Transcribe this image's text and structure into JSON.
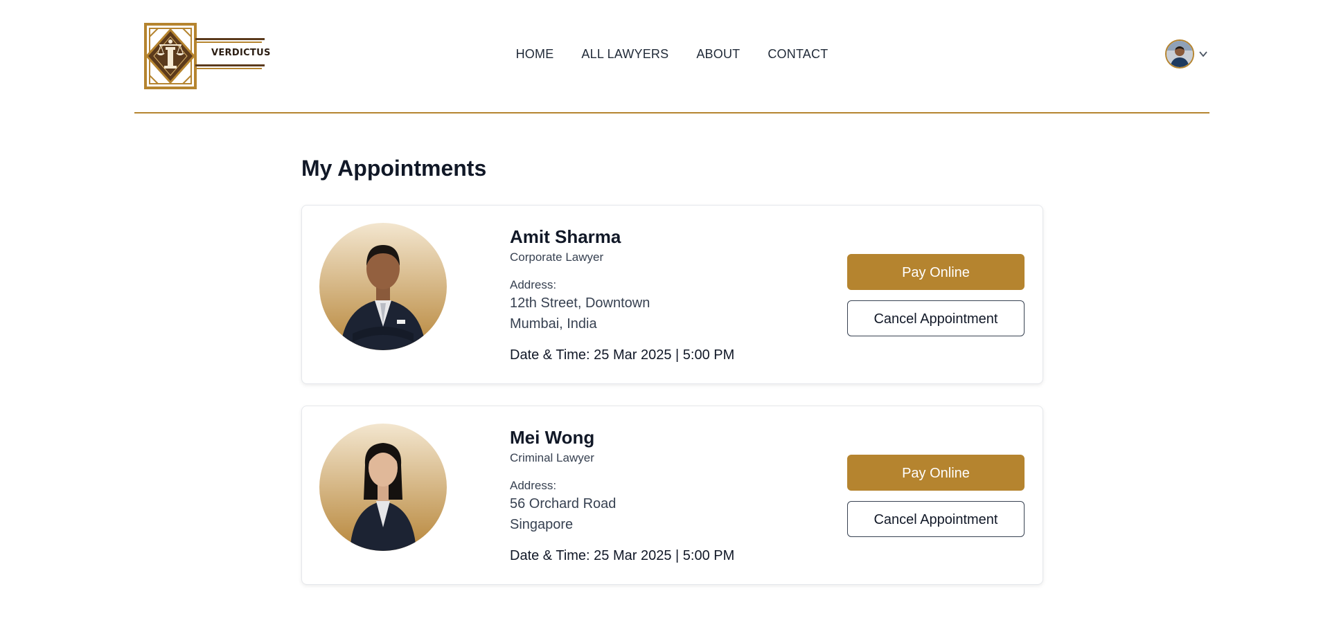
{
  "brand": {
    "name": "VERDICTUS",
    "accent_color": "#b5842f",
    "dark_color": "#5b3a1c"
  },
  "nav": {
    "items": [
      {
        "label": "HOME"
      },
      {
        "label": "ALL LAWYERS"
      },
      {
        "label": "ABOUT"
      },
      {
        "label": "CONTACT"
      }
    ]
  },
  "profile": {
    "avatar_icon": "user-avatar",
    "menu_icon": "chevron-down-icon"
  },
  "page": {
    "title": "My Appointments"
  },
  "appointments": [
    {
      "name": "Amit Sharma",
      "specialty": "Corporate Lawyer",
      "address_label": "Address:",
      "address_line1": "12th Street, Downtown",
      "address_line2": "Mumbai, India",
      "datetime_label": "Date & Time:",
      "datetime_value": "25 Mar 2025 | 5:00 PM",
      "pay_label": "Pay Online",
      "cancel_label": "Cancel Appointment"
    },
    {
      "name": "Mei Wong",
      "specialty": "Criminal Lawyer",
      "address_label": "Address:",
      "address_line1": "56 Orchard Road",
      "address_line2": "Singapore",
      "datetime_label": "Date & Time:",
      "datetime_value": "25 Mar 2025 | 5:00 PM",
      "pay_label": "Pay Online",
      "cancel_label": "Cancel Appointment"
    }
  ]
}
